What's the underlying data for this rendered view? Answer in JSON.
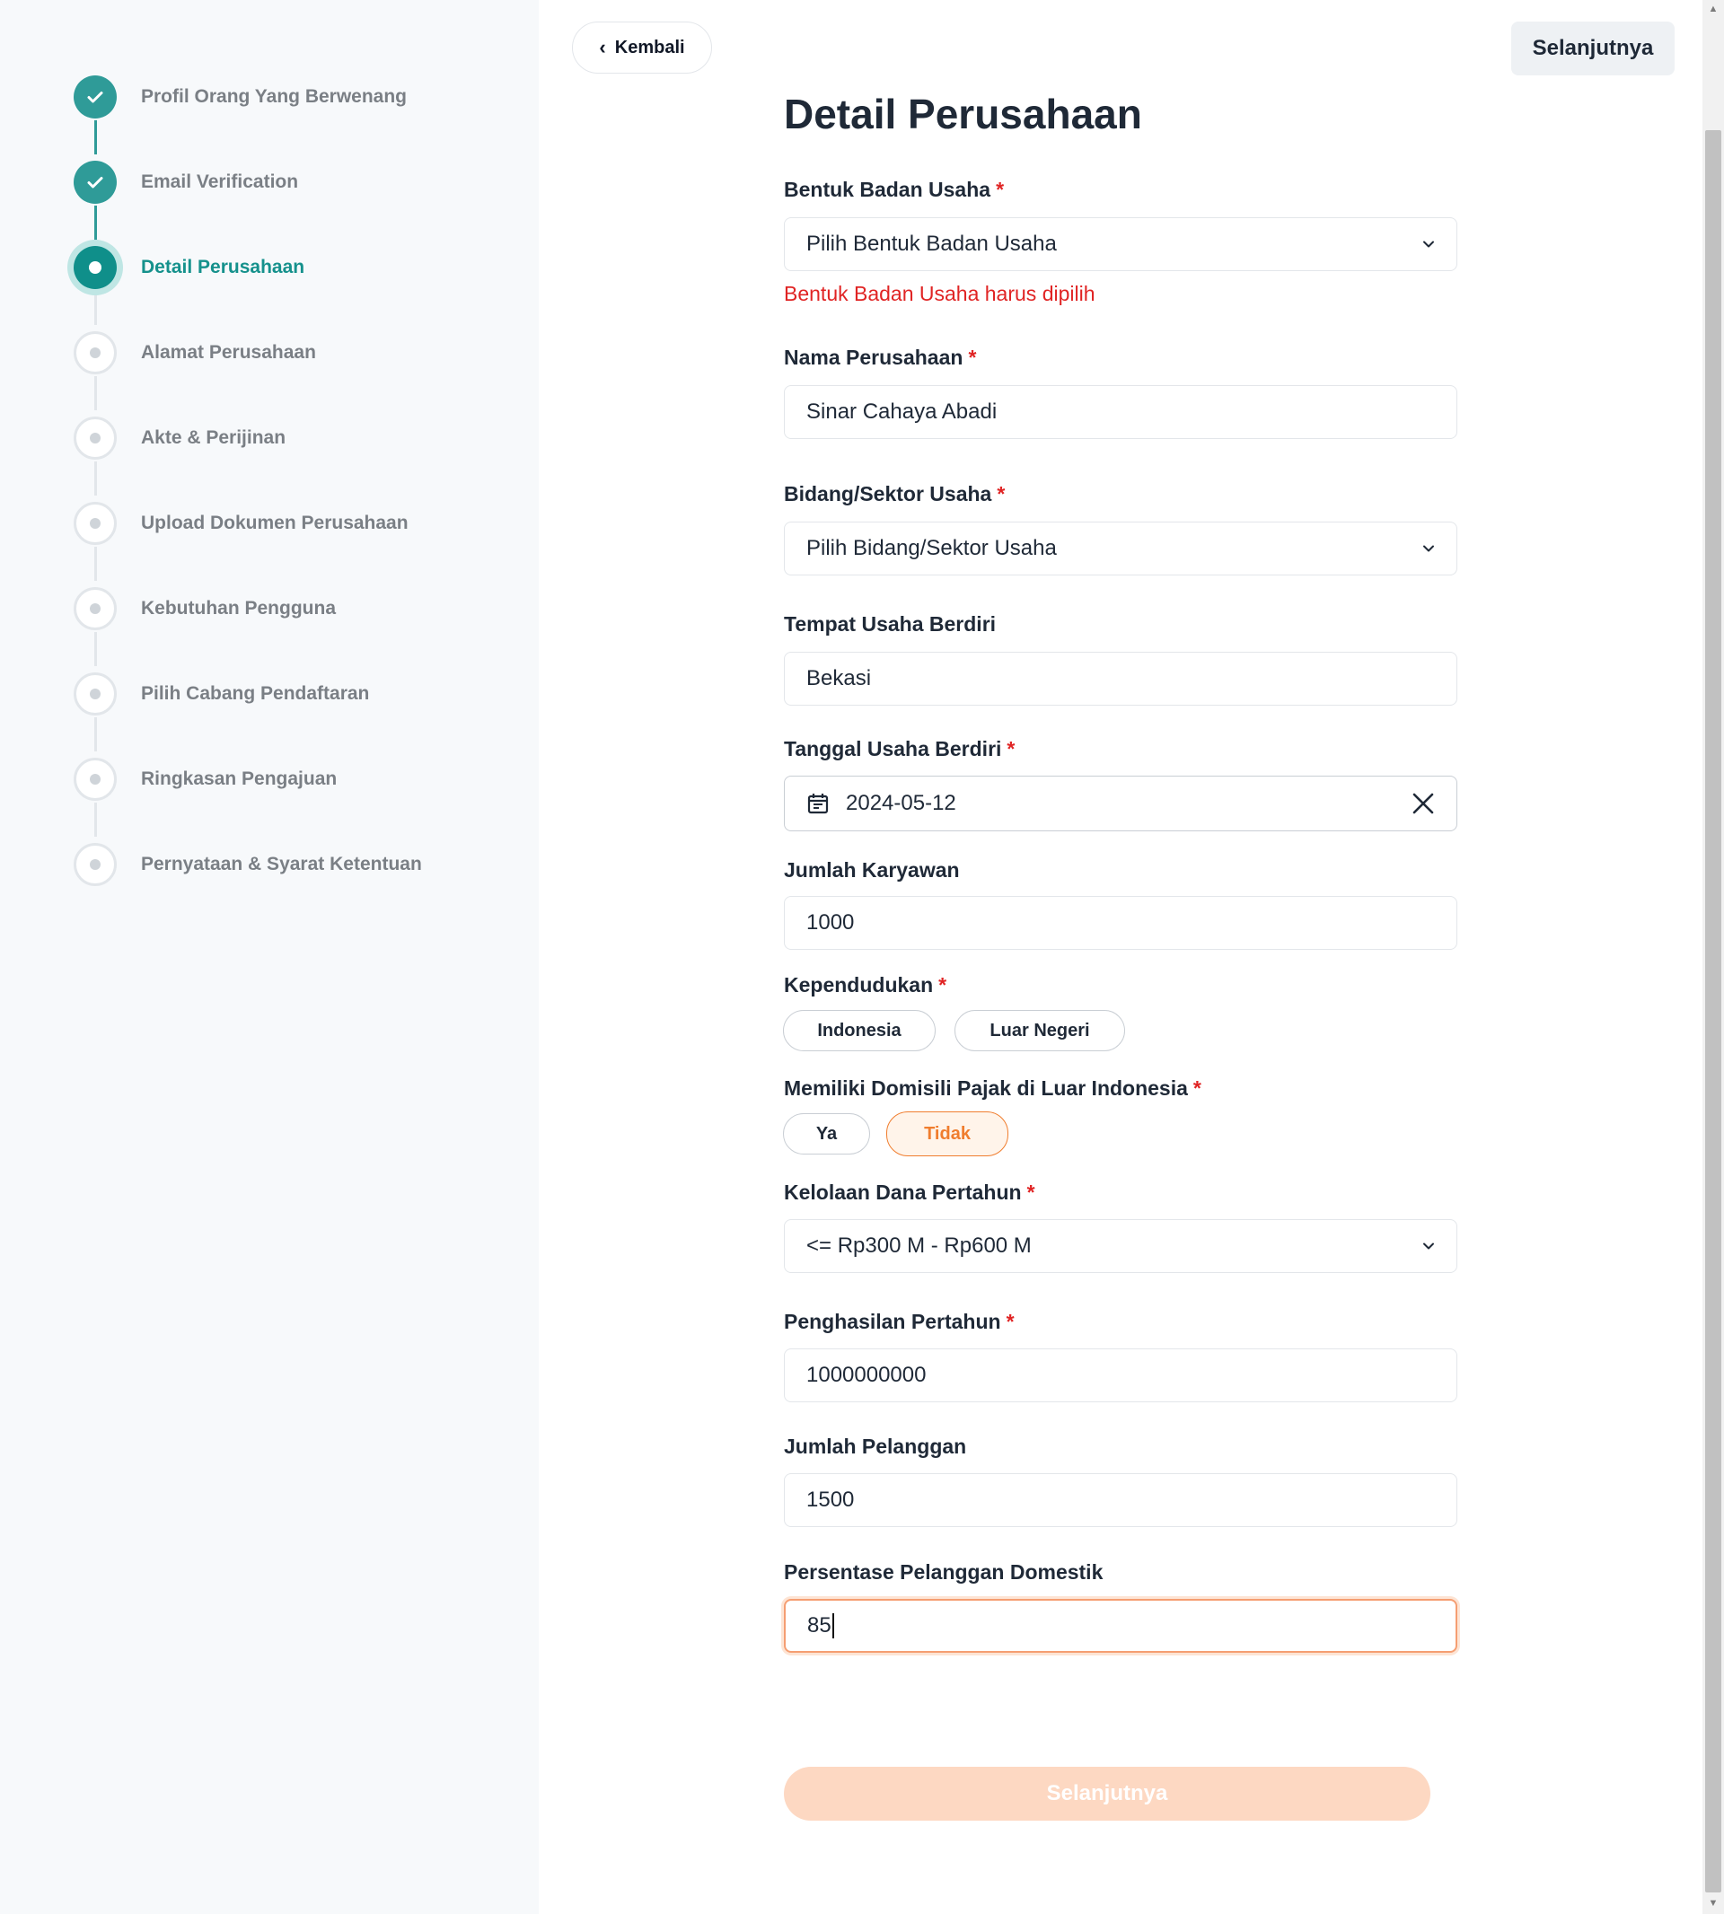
{
  "sidebar": {
    "steps": [
      {
        "label": "Profil Orang Yang Berwenang",
        "status": "done"
      },
      {
        "label": "Email Verification",
        "status": "done"
      },
      {
        "label": "Detail Perusahaan",
        "status": "active"
      },
      {
        "label": "Alamat Perusahaan",
        "status": "pending"
      },
      {
        "label": "Akte & Perijinan",
        "status": "pending"
      },
      {
        "label": "Upload Dokumen Perusahaan",
        "status": "pending"
      },
      {
        "label": "Kebutuhan Pengguna",
        "status": "pending"
      },
      {
        "label": "Pilih Cabang Pendaftaran",
        "status": "pending"
      },
      {
        "label": "Ringkasan Pengajuan",
        "status": "pending"
      },
      {
        "label": "Pernyataan & Syarat Ketentuan",
        "status": "pending"
      }
    ]
  },
  "header": {
    "back_label": "Kembali",
    "next_label": "Selanjutnya"
  },
  "form": {
    "title": "Detail Perusahaan",
    "required_mark": "*",
    "bentuk_badan_usaha": {
      "label": "Bentuk Badan Usaha",
      "value": "Pilih Bentuk Badan Usaha",
      "error": "Bentuk Badan Usaha harus dipilih"
    },
    "nama_perusahaan": {
      "label": "Nama Perusahaan",
      "value": "Sinar Cahaya Abadi"
    },
    "bidang_sektor": {
      "label": "Bidang/Sektor Usaha",
      "value": "Pilih Bidang/Sektor Usaha"
    },
    "tempat_usaha": {
      "label": "Tempat Usaha Berdiri",
      "value": "Bekasi"
    },
    "tanggal_usaha": {
      "label": "Tanggal Usaha Berdiri",
      "value": "2024-05-12"
    },
    "jumlah_karyawan": {
      "label": "Jumlah Karyawan",
      "value": "1000"
    },
    "kependudukan": {
      "label": "Kependudukan",
      "options": [
        "Indonesia",
        "Luar Negeri"
      ],
      "selected": null
    },
    "domisili_pajak": {
      "label": "Memiliki Domisili Pajak di Luar Indonesia",
      "options": [
        "Ya",
        "Tidak"
      ],
      "selected": "Tidak"
    },
    "kelolaan_dana": {
      "label": "Kelolaan Dana Pertahun",
      "value": "<= Rp300 M - Rp600 M"
    },
    "penghasilan": {
      "label": "Penghasilan Pertahun",
      "value": "1000000000"
    },
    "jumlah_pelanggan": {
      "label": "Jumlah Pelanggan",
      "value": "1500"
    },
    "persentase_domestik": {
      "label": "Persentase Pelanggan Domestik",
      "value": "85"
    },
    "submit_label": "Selanjutnya"
  },
  "colors": {
    "accent_teal": "#2f9b98",
    "accent_orange": "#f07d2e",
    "error_red": "#e02424"
  }
}
